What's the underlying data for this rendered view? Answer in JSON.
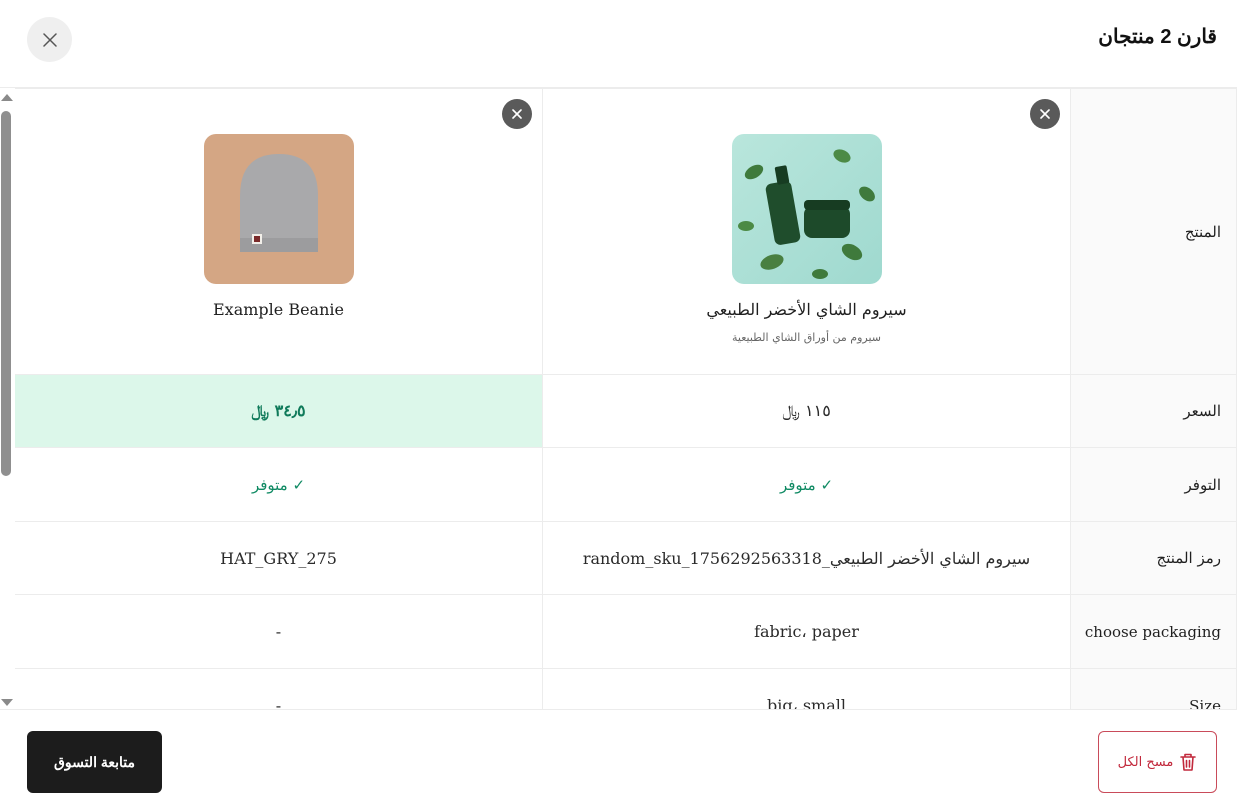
{
  "header": {
    "title": "قارن 2 منتجان"
  },
  "table": {
    "row_labels": {
      "product": "المنتج",
      "price": "السعر",
      "availability": "التوفر",
      "sku": "رمز المنتج",
      "packaging": "choose packaging",
      "size": "Size"
    },
    "products": [
      {
        "name": "سيروم الشاي الأخضر الطبيعي",
        "description": "سيروم من أوراق الشاي الطبيعية",
        "price": "١١٥ ﷼",
        "availability": "✓ متوفر",
        "sku": "سيروم الشاي الأخضر الطبيعي_random_sku_1756292563318",
        "packaging": "fabric، paper",
        "size": "big، small"
      },
      {
        "name": "Example Beanie",
        "description": "",
        "price": "٣٤٫٥ ﷼",
        "availability": "✓ متوفر",
        "sku": "HAT_GRY_275",
        "packaging": "-",
        "size": "-"
      }
    ]
  },
  "footer": {
    "continue_label": "متابعة التسوق",
    "clear_label": "مسح الكل"
  },
  "colors": {
    "best_price_bg": "#dcf7ea",
    "best_price_text": "#0f7a5a",
    "available_text": "#0f8a63",
    "clear_button": "#c2293c",
    "primary_button": "#1c1c1c"
  },
  "icons": {
    "close": "close-icon",
    "remove": "remove-product-icon",
    "trash": "trash-icon"
  }
}
